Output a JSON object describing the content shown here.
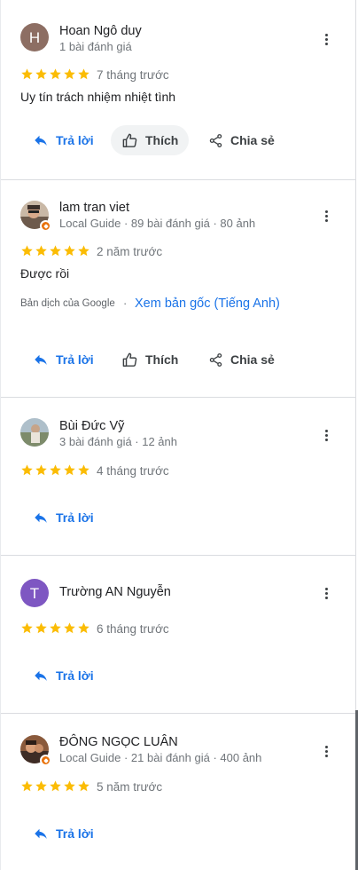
{
  "colors": {
    "star": "#fbbc04",
    "link": "#1a73e8",
    "guide_badge": "#e8710a"
  },
  "actions": {
    "reply": "Trả lời",
    "like": "Thích",
    "share": "Chia sẻ"
  },
  "reviews": [
    {
      "avatar_letter": "H",
      "avatar_color": "#8d6e63",
      "name": "Hoan Ngô duy",
      "meta": "1 bài đánh giá",
      "rating": 5,
      "when": "7 tháng trước",
      "text": "Uy tín trách nhiệm nhiệt tình"
    },
    {
      "avatar": "profile-photo",
      "local_guide": true,
      "name": "lam tran viet",
      "meta": "Local Guide · 89 bài đánh giá · 80 ảnh",
      "rating": 5,
      "when": "2 năm trước",
      "text": "Được rồi",
      "translation_note": "Bản dịch của Google",
      "separator": "·",
      "original_link": "Xem bản gốc (Tiếng Anh)"
    },
    {
      "avatar": "profile-photo",
      "name": "Bùi Đức Vỹ",
      "meta": "3 bài đánh giá · 12 ảnh",
      "rating": 5,
      "when": "4 tháng trước"
    },
    {
      "avatar_letter": "T",
      "avatar_color": "#7e57c2",
      "name": "Trường AN Nguyễn",
      "rating": 5,
      "when": "6 tháng trước"
    },
    {
      "avatar": "profile-photo",
      "local_guide": true,
      "name": "ĐÔNG NGỌC LUÂN",
      "meta": "Local Guide · 21 bài đánh giá · 400 ảnh",
      "rating": 5,
      "when": "5 năm trước"
    }
  ]
}
